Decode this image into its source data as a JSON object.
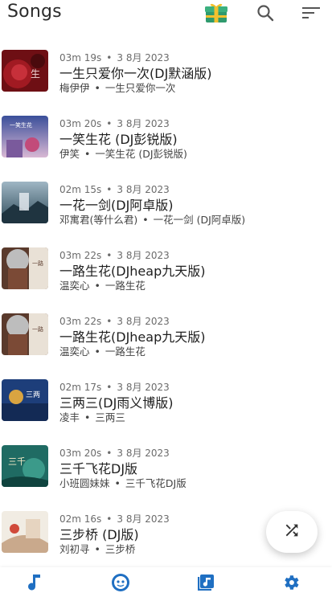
{
  "header": {
    "title": "Songs",
    "icons": [
      "gift-icon",
      "search-icon",
      "sort-icon"
    ]
  },
  "colors": {
    "accent": "#1f6fc2",
    "text_primary": "#1e1e1e",
    "text_secondary": "#6b6b6b"
  },
  "songs": [
    {
      "duration": "03m 19s",
      "date": "3 8月 2023",
      "title": "一生只爱你一次(DJ默涵版)",
      "artist": "梅伊伊",
      "album": "一生只爱你一次"
    },
    {
      "duration": "03m 20s",
      "date": "3 8月 2023",
      "title": "一笑生花 (DJ彭锐版)",
      "artist": "伊笑",
      "album": "一笑生花 (DJ彭锐版)"
    },
    {
      "duration": "02m 15s",
      "date": "3 8月 2023",
      "title": "一花一剑(DJ阿卓版)",
      "artist": "邓寓君(等什么君)",
      "album": "一花一剑 (DJ阿卓版)"
    },
    {
      "duration": "03m 22s",
      "date": "3 8月 2023",
      "title": "一路生花(DJheap九天版)",
      "artist": "温奕心",
      "album": "一路生花"
    },
    {
      "duration": "03m 22s",
      "date": "3 8月 2023",
      "title": "一路生花(DJheap九天版)",
      "artist": "温奕心",
      "album": "一路生花"
    },
    {
      "duration": "02m 17s",
      "date": "3 8月 2023",
      "title": "三两三(DJ雨义博版)",
      "artist": "凌丰",
      "album": "三两三"
    },
    {
      "duration": "03m 20s",
      "date": "3 8月 2023",
      "title": "三千飞花DJ版",
      "artist": "小班圆妹妹",
      "album": "三千飞花DJ版"
    },
    {
      "duration": "02m 16s",
      "date": "3 8月 2023",
      "title": "三步桥 (DJ版)",
      "artist": "刘初寻",
      "album": "三步桥"
    }
  ],
  "separator": "•",
  "fab": {
    "icon": "shuffle-icon"
  },
  "bottom_nav": {
    "items": [
      {
        "icon": "music-note-icon",
        "name": "songs"
      },
      {
        "icon": "artist-icon",
        "name": "artists"
      },
      {
        "icon": "album-icon",
        "name": "albums"
      },
      {
        "icon": "settings-icon",
        "name": "settings"
      }
    ]
  }
}
